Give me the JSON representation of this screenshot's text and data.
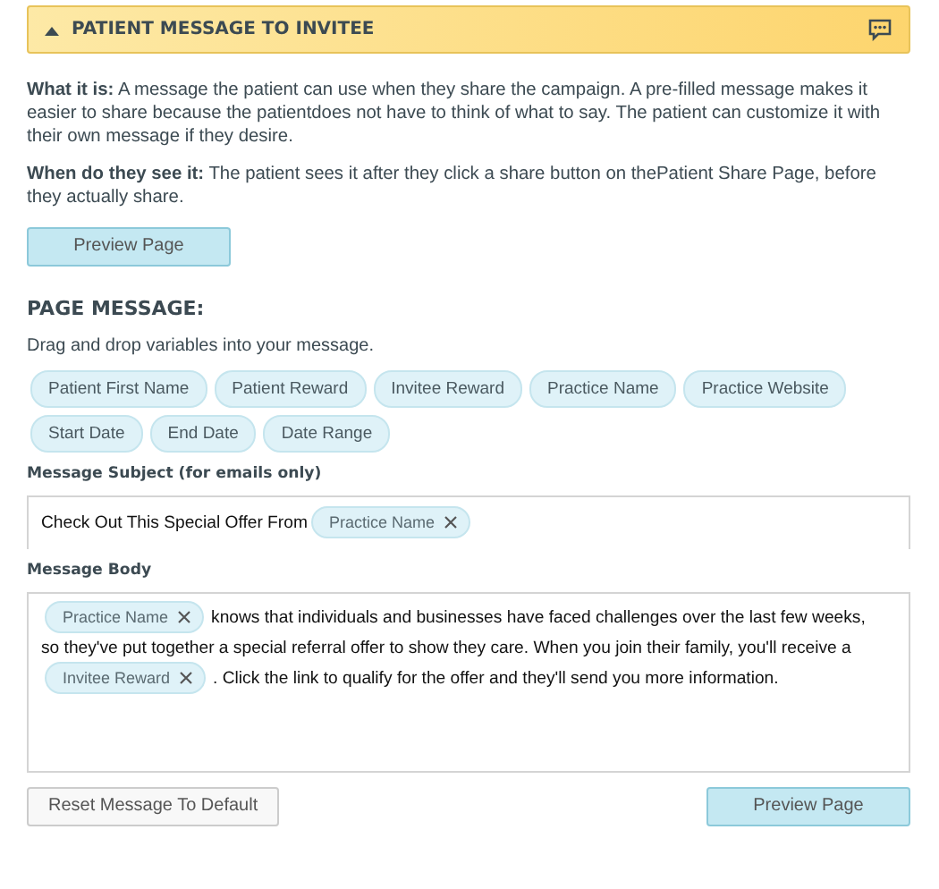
{
  "section": {
    "title": "PATIENT MESSAGE TO INVITEE",
    "expanded": true
  },
  "info": [
    {
      "label": "What it is:",
      "text": "A message the patient can use when they share the campaign. A pre-filled message makes it easier to share because the patientdoes not have to think of what to say. The patient can customize it with their own message if they desire."
    },
    {
      "label": "When do they see it:",
      "text": "The patient sees it after they click a share button on thePatient Share Page, before they actually share."
    }
  ],
  "preview_button_top": "Preview Page",
  "page_message": {
    "heading": "PAGE MESSAGE:",
    "hint": "Drag and drop variables into your message."
  },
  "variables": [
    "Patient First Name",
    "Patient Reward",
    "Invitee Reward",
    "Practice Name",
    "Practice Website",
    "Start Date",
    "End Date",
    "Date Range"
  ],
  "subject": {
    "label": "Message Subject (for emails only)",
    "lines": [
      [
        {
          "kind": "text",
          "text": "Check Out This Special Offer From"
        },
        {
          "kind": "token",
          "text": "Practice Name"
        }
      ]
    ]
  },
  "body": {
    "label": "Message Body",
    "lines": [
      [
        {
          "kind": "token",
          "text": "Practice Name"
        },
        {
          "kind": "text",
          "text": "knows that individuals and businesses have faced challenges over the last few weeks,"
        }
      ],
      [
        {
          "kind": "text",
          "text": "so they've put together a special referral offer to show they care. When you join their family, you'll receive a"
        }
      ],
      [
        {
          "kind": "token",
          "text": "Invitee Reward"
        },
        {
          "kind": "text",
          "text": ". Click the link to qualify for the offer and they'll send you more information."
        }
      ]
    ]
  },
  "buttons": {
    "reset": "Reset Message To Default",
    "preview": "Preview Page"
  }
}
